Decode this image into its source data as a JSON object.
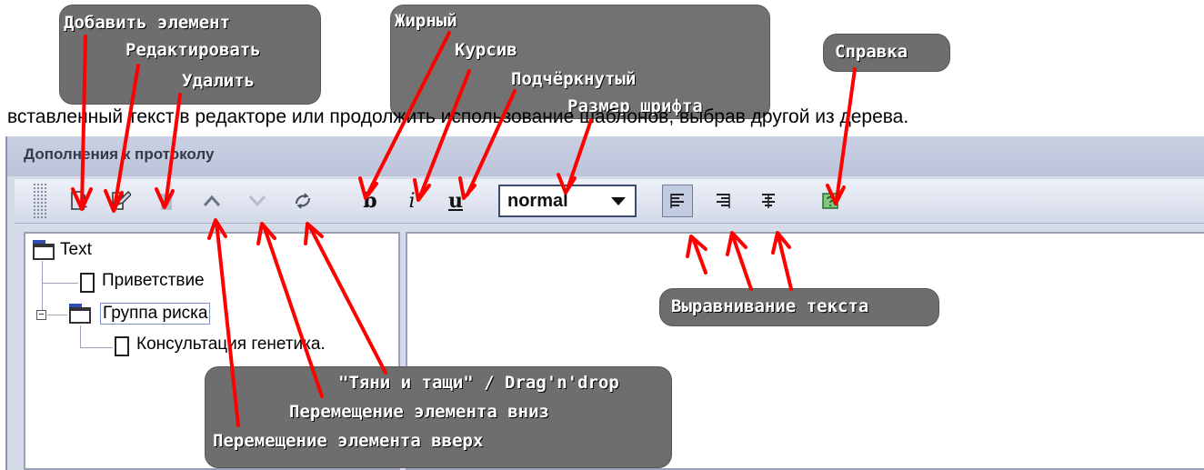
{
  "intro_text": "вставленный текст в редакторе или продолжить использование шаблонов, выбрав другой из дерева.",
  "window": {
    "title": "Дополнения к протоколу"
  },
  "toolbar": {
    "font_size": {
      "value": "normal"
    }
  },
  "tree": {
    "root": "Text",
    "items": [
      {
        "label": "Приветствие"
      },
      {
        "label": "Группа риска"
      },
      {
        "label": "Консультация генетика."
      }
    ]
  },
  "callouts": {
    "add": "Добавить элемент",
    "edit": "Редактировать",
    "delete": "Удалить",
    "bold": "Жирный",
    "italic": "Курсив",
    "underline": "Подчёркнутый",
    "font_size": "Размер шрифта",
    "help": "Справка",
    "align": "Выравнивание текста",
    "drag": "\"Тяни и тащи\" / Drag'n'drop",
    "move_down": "Перемещение элемента вниз",
    "move_up": "Перемещение элемента вверх"
  },
  "icons": {
    "add": "add-item-icon",
    "edit": "edit-icon",
    "delete": "trash-icon",
    "move_up": "chevron-up-icon",
    "move_down": "chevron-down-icon",
    "drag": "drag-drop-icon",
    "bold": "bold-icon",
    "italic": "italic-icon",
    "underline": "underline-icon",
    "align_left": "align-left-icon",
    "align_right": "align-right-icon",
    "align_center": "align-center-icon",
    "help": "help-icon"
  },
  "colors": {
    "arrow": "#ff0000",
    "callout": "#6e6e6e"
  }
}
